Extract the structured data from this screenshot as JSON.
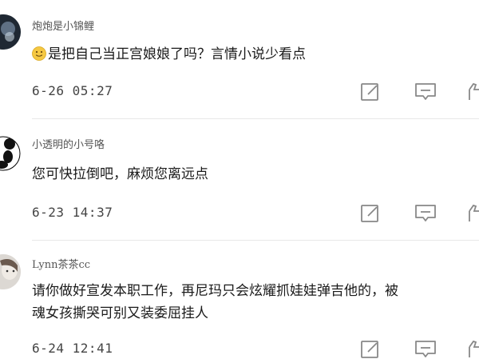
{
  "comments": [
    {
      "username": "炮炮是小锦鲤",
      "emoji": "slightly-smiling-face-icon",
      "text": "是把自己当正宫娘娘了吗？言情小说少看点",
      "time": "6-26 05:27"
    },
    {
      "username": "小透明的小号咯",
      "text": "您可快拉倒吧，麻烦您离远点",
      "time": "6-23 14:37"
    },
    {
      "username": "Lynn茶茶cc",
      "text_line1": "请你做好宣发本职工作，再尼玛只会炫耀抓娃娃弹吉他的，被",
      "text_line2": "魂女孩撕哭可别又装委屈挂人",
      "time": "6-24 12:41"
    }
  ],
  "icons": {
    "edit": "edit-icon",
    "comment": "comment-icon",
    "like": "like-icon"
  },
  "colors": {
    "icon": "#888888",
    "divider": "#e8e8e8",
    "time": "#444444"
  }
}
